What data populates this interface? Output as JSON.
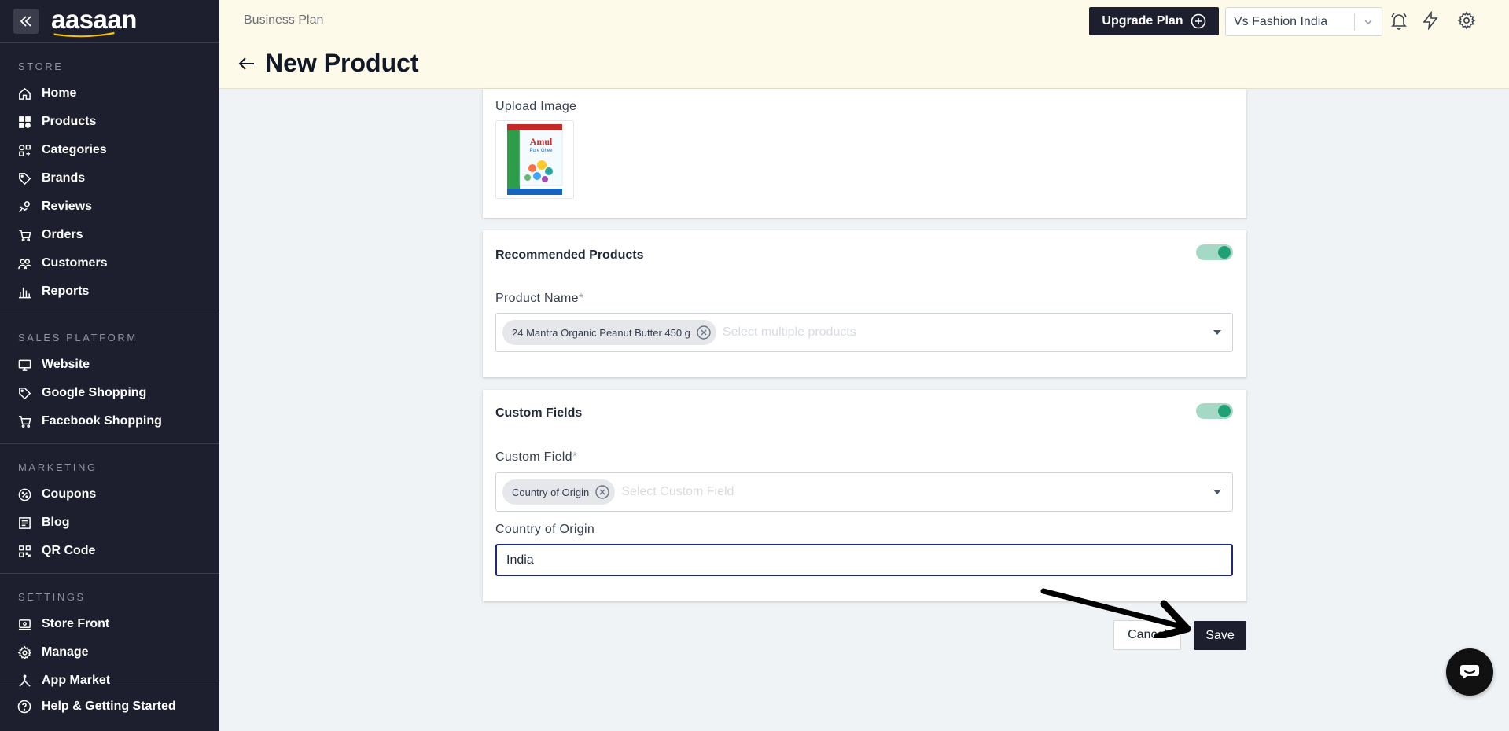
{
  "sidebar": {
    "logo": "aasaan",
    "sections": [
      {
        "title": "STORE",
        "items": [
          {
            "label": "Home",
            "icon": "home-icon"
          },
          {
            "label": "Products",
            "icon": "products-icon"
          },
          {
            "label": "Categories",
            "icon": "categories-icon"
          },
          {
            "label": "Brands",
            "icon": "tag-icon"
          },
          {
            "label": "Reviews",
            "icon": "reviews-icon"
          },
          {
            "label": "Orders",
            "icon": "cart-icon"
          },
          {
            "label": "Customers",
            "icon": "customers-icon"
          },
          {
            "label": "Reports",
            "icon": "reports-icon"
          }
        ]
      },
      {
        "title": "SALES PLATFORM",
        "items": [
          {
            "label": "Website",
            "icon": "monitor-icon"
          },
          {
            "label": "Google Shopping",
            "icon": "tag-icon"
          },
          {
            "label": "Facebook Shopping",
            "icon": "cart-icon"
          }
        ]
      },
      {
        "title": "MARKETING",
        "items": [
          {
            "label": "Coupons",
            "icon": "coupon-icon"
          },
          {
            "label": "Blog",
            "icon": "blog-icon"
          },
          {
            "label": "QR Code",
            "icon": "qr-icon"
          }
        ]
      },
      {
        "title": "SETTINGS",
        "items": [
          {
            "label": "Store Front",
            "icon": "storefront-icon"
          },
          {
            "label": "Manage",
            "icon": "gear-icon"
          },
          {
            "label": "App Market",
            "icon": "app-market-icon"
          }
        ]
      }
    ],
    "help_label": "Help & Getting Started"
  },
  "header": {
    "plan": "Business Plan",
    "title": "New Product",
    "upgrade_label": "Upgrade Plan",
    "store_name": "Vs Fashion India"
  },
  "upload": {
    "label": "Upload Image",
    "image_brand": "Amul",
    "image_subtitle": "Pure Ghee"
  },
  "recommended": {
    "title": "Recommended Products",
    "enabled": true,
    "field_label": "Product Name",
    "required_mark": "*",
    "chip": "24 Mantra Organic Peanut Butter 450 g",
    "placeholder": "Select multiple products"
  },
  "custom_fields": {
    "title": "Custom Fields",
    "enabled": true,
    "field_label": "Custom Field",
    "required_mark": "*",
    "chip": "Country of Origin",
    "placeholder": "Select Custom Field",
    "origin_label": "Country of Origin",
    "origin_value": "India"
  },
  "actions": {
    "cancel_label": "Cancel",
    "save_label": "Save"
  },
  "colors": {
    "sidebar_bg": "#1e1f2e",
    "header_bg": "#fefaea",
    "toggle_on": "#1fa077",
    "focus_border": "#1e2a78"
  }
}
